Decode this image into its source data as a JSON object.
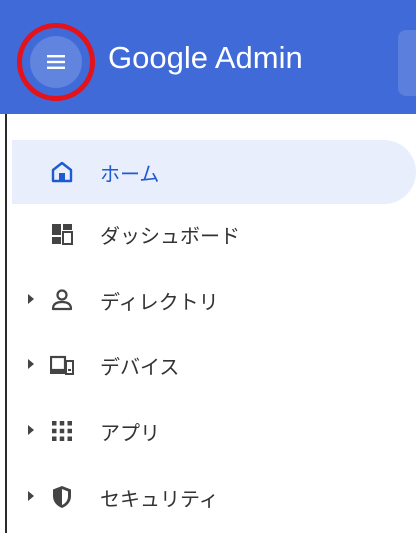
{
  "header": {
    "menu_icon": "hamburger-menu-icon",
    "brand": "Google Admin",
    "bar_color": "#3f6ad8",
    "highlight_color": "#e3121b"
  },
  "nav": {
    "items": [
      {
        "label": "ホーム",
        "icon": "home-icon",
        "active": true,
        "expandable": false
      },
      {
        "label": "ダッシュボード",
        "icon": "dashboard-icon",
        "active": false,
        "expandable": false
      },
      {
        "label": "ディレクトリ",
        "icon": "person-icon",
        "active": false,
        "expandable": true
      },
      {
        "label": "デバイス",
        "icon": "devices-icon",
        "active": false,
        "expandable": true
      },
      {
        "label": "アプリ",
        "icon": "apps-grid-icon",
        "active": false,
        "expandable": true
      },
      {
        "label": "セキュリティ",
        "icon": "shield-icon",
        "active": false,
        "expandable": true
      }
    ],
    "active_color": "#1f5ad0",
    "active_bg": "#e8eefb"
  }
}
